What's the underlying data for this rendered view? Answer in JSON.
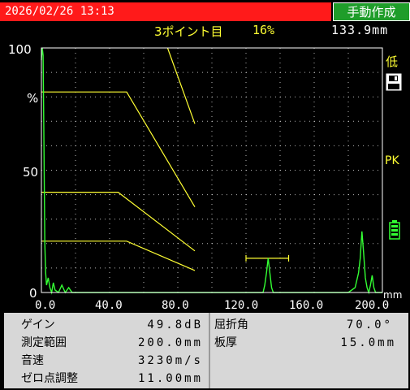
{
  "header": {
    "datetime": "2026/02/26 13:13",
    "mode_button": "手動作成"
  },
  "readout": {
    "gate_label": "3ポイント目",
    "amplitude": "16%",
    "distance": "133.9mm"
  },
  "side": {
    "low_label": "低",
    "pk_label": "PK"
  },
  "colors": {
    "datetime_bg": "#ff1a1a",
    "mode_bg": "#1f9d2a",
    "waveform": "#33ff33",
    "curve": "#ffff33",
    "panel_bg": "#d7d7d7"
  },
  "icons": [
    "save-icon",
    "battery-icon"
  ],
  "chart_data": {
    "type": "line",
    "xlabel": "mm",
    "ylabel": "%",
    "xlim": [
      0,
      200
    ],
    "ylim": [
      0,
      100
    ],
    "x_ticks": [
      "0.0",
      "40.0",
      "80.0",
      "120.0",
      "160.0",
      "200.0"
    ],
    "y_ticks": [
      "100",
      "%",
      "50",
      "0"
    ],
    "grid": true,
    "dac_curves": [
      [
        [
          0,
          82
        ],
        [
          50,
          82
        ],
        [
          90,
          35
        ]
      ],
      [
        [
          0,
          41
        ],
        [
          45,
          41
        ],
        [
          90,
          17
        ]
      ],
      [
        [
          0,
          21
        ],
        [
          50,
          21
        ],
        [
          90,
          9
        ]
      ]
    ],
    "cursor_line": [
      [
        74,
        100
      ],
      [
        90,
        69
      ]
    ],
    "gate": {
      "x_start": 120,
      "x_end": 145,
      "level": 14
    },
    "echo_series": [
      [
        0,
        95
      ],
      [
        0.5,
        100
      ],
      [
        1,
        97
      ],
      [
        1.5,
        60
      ],
      [
        2,
        20
      ],
      [
        2.5,
        8
      ],
      [
        3,
        3
      ],
      [
        4,
        6
      ],
      [
        5,
        2
      ],
      [
        6,
        0
      ],
      [
        7,
        4
      ],
      [
        8,
        1
      ],
      [
        10,
        0
      ],
      [
        12,
        3
      ],
      [
        14,
        0
      ],
      [
        16,
        2
      ],
      [
        18,
        0
      ],
      [
        30,
        0
      ],
      [
        60,
        0
      ],
      [
        100,
        0
      ],
      [
        130,
        0
      ],
      [
        131,
        3
      ],
      [
        132,
        8
      ],
      [
        133,
        14
      ],
      [
        134,
        8
      ],
      [
        135,
        2
      ],
      [
        136,
        0
      ],
      [
        180,
        0
      ],
      [
        184,
        2
      ],
      [
        186,
        8
      ],
      [
        187,
        14
      ],
      [
        188,
        25
      ],
      [
        189,
        16
      ],
      [
        190,
        6
      ],
      [
        191,
        2
      ],
      [
        192,
        0
      ],
      [
        193,
        3
      ],
      [
        194,
        7
      ],
      [
        195,
        2
      ],
      [
        196,
        0
      ],
      [
        200,
        0
      ]
    ]
  },
  "settings": {
    "gain_label": "ゲイン",
    "gain_value": "49.8dB",
    "range_label": "測定範囲",
    "range_value": "200.0mm",
    "velocity_label": "音速",
    "velocity_value": "3230m/s",
    "zero_label": "ゼロ点調整",
    "zero_value": "11.00mm",
    "angle_label": "屈折角",
    "angle_value": "70.0°",
    "thickness_label": "板厚",
    "thickness_value": "15.0mm"
  }
}
